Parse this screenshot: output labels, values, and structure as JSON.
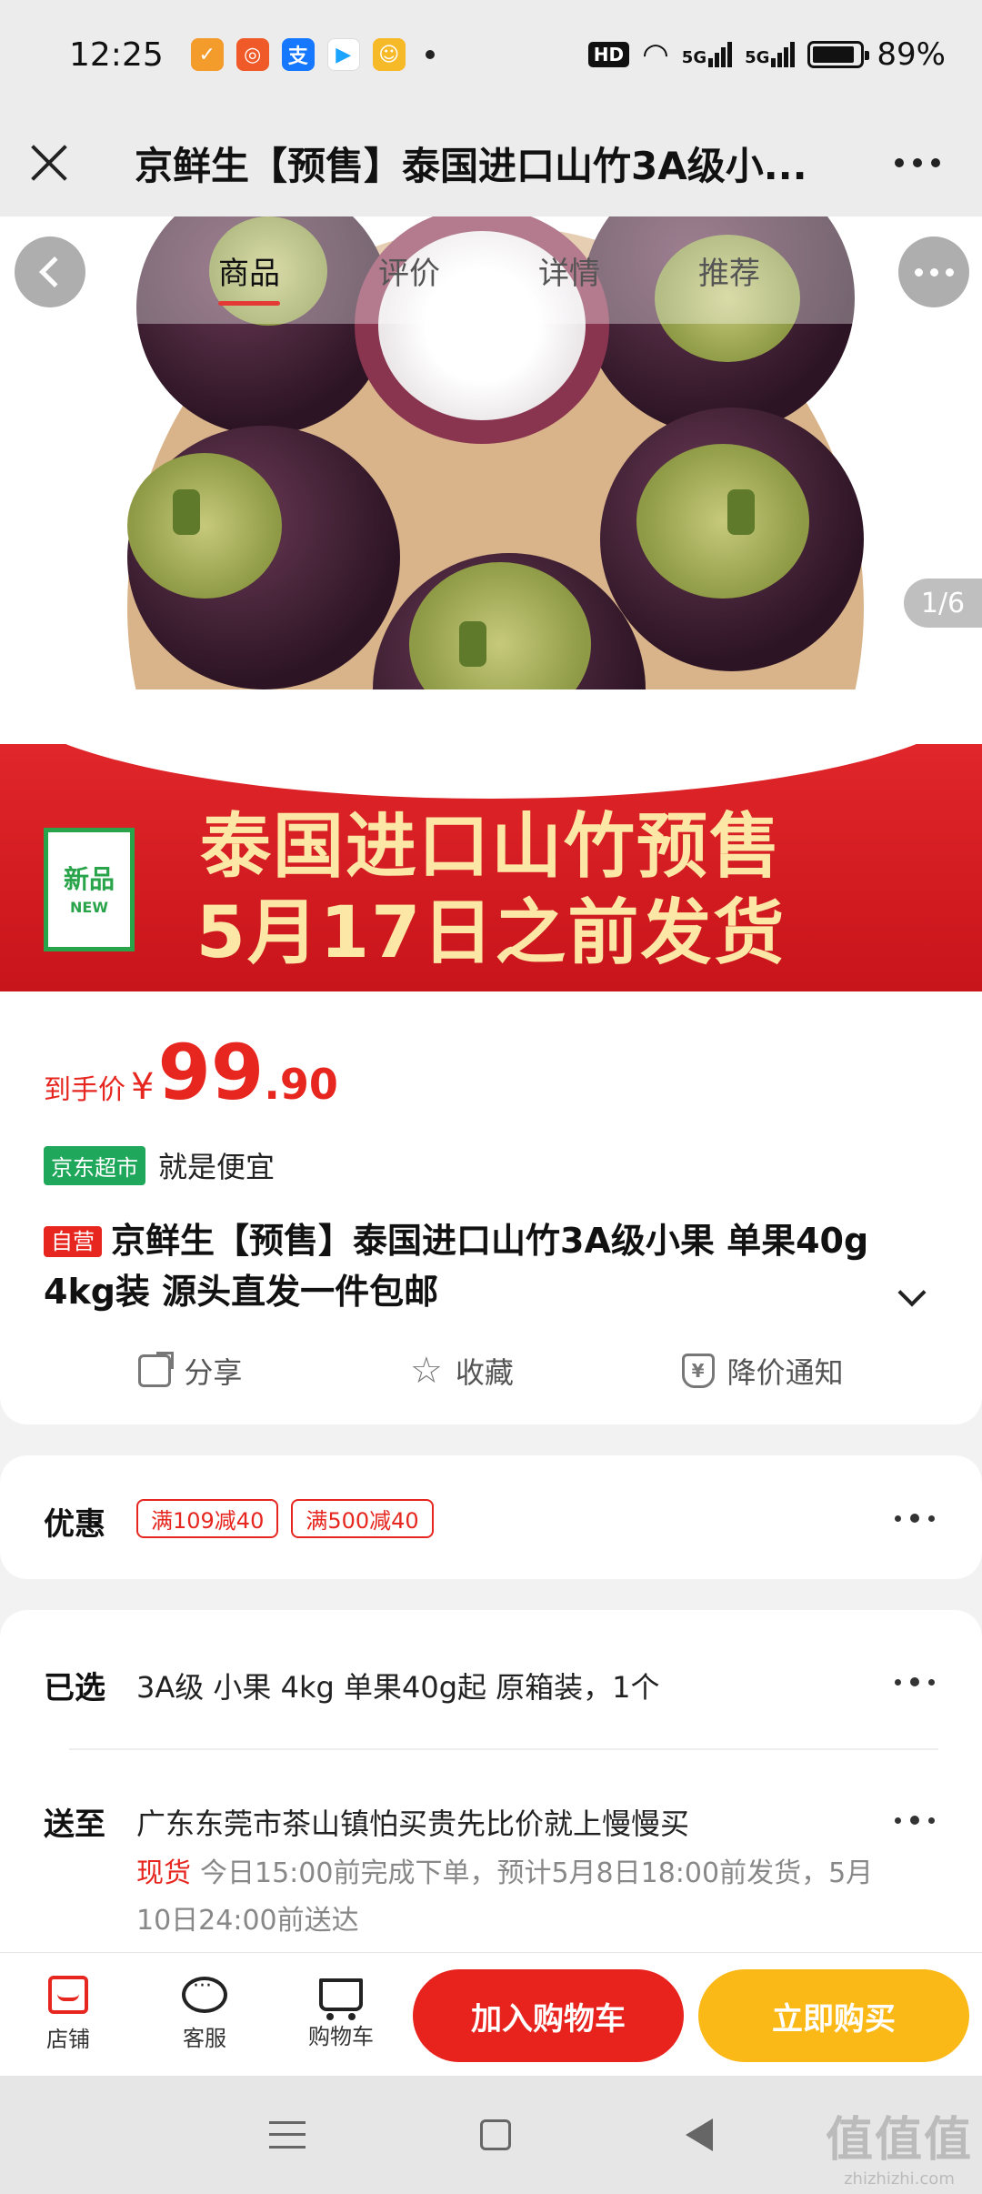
{
  "status_bar": {
    "time": "12:25",
    "battery": "89%",
    "hd_label": "HD",
    "network_1": "5G",
    "network_2": "5G"
  },
  "header": {
    "title": "京鲜生【预售】泰国进口山竹3A级小..."
  },
  "tabs": [
    {
      "label": "商品",
      "active": true
    },
    {
      "label": "评价",
      "active": false
    },
    {
      "label": "详情",
      "active": false
    },
    {
      "label": "推荐",
      "active": false
    }
  ],
  "hero": {
    "banner_line1": "泰国进口山竹预售",
    "banner_line2": "5月17日之前发货",
    "badge_cn": "新品",
    "badge_en": "NEW",
    "pager": "1/6"
  },
  "price": {
    "label": "到手价",
    "currency": "¥",
    "integer": "99",
    "decimal": ".90"
  },
  "store": {
    "badge": "京东超市",
    "slogan": "就是便宜"
  },
  "product": {
    "self_badge": "自营",
    "title": "京鲜生【预售】泰国进口山竹3A级小果 单果40g 4kg装 源头直发一件包邮"
  },
  "actions": {
    "share": "分享",
    "favorite": "收藏",
    "price_alert": "降价通知"
  },
  "discount": {
    "label": "优惠",
    "coupons": [
      "满109减40",
      "满500减40"
    ]
  },
  "selection": {
    "label": "已选",
    "value": "3A级 小果 4kg 单果40g起 原箱装，1个"
  },
  "shipping": {
    "label": "送至",
    "address": "广东东莞市茶山镇怕买贵先比价就上慢慢买",
    "stock": "现货",
    "note": "今日15:00前完成下单，预计5月8日18:00前发货，5月10日24:00前送达"
  },
  "bottom_bar": {
    "store": "店铺",
    "service": "客服",
    "cart": "购物车",
    "add_to_cart": "加入购物车",
    "buy_now": "立即购买"
  },
  "watermark": {
    "text": "值值值",
    "domain": "zhizhizhi.com"
  },
  "colors": {
    "accent_red": "#e8221d",
    "buy_yellow": "#fbb917",
    "jd_green": "#1fa85b"
  }
}
